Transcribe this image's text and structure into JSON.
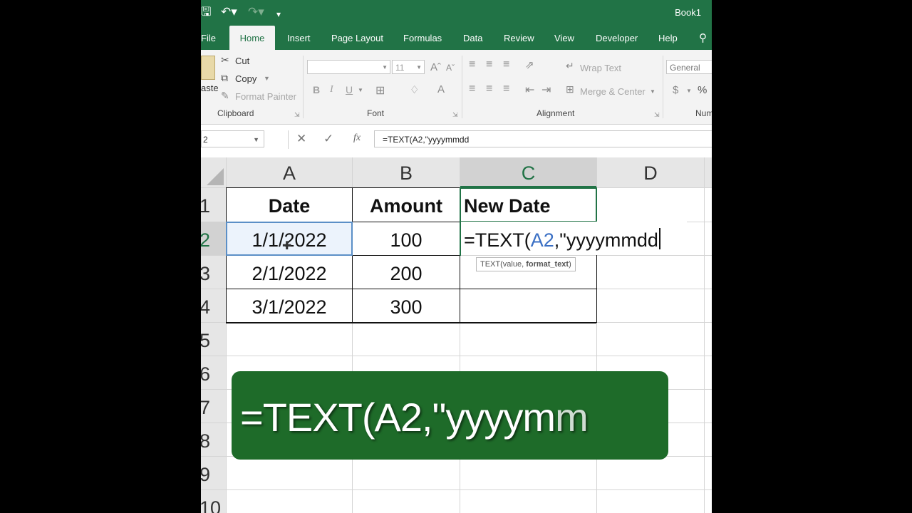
{
  "titlebar": {
    "book_title": "Book1"
  },
  "tabs": [
    "File",
    "Home",
    "Insert",
    "Page Layout",
    "Formulas",
    "Data",
    "Review",
    "View",
    "Developer",
    "Help"
  ],
  "active_tab": "Home",
  "ribbon": {
    "clipboard": {
      "paste": "aste",
      "cut": "Cut",
      "copy": "Copy",
      "format_painter": "Format Painter",
      "label": "Clipboard"
    },
    "font": {
      "name": "",
      "size": "11",
      "label": "Font",
      "bold": "B",
      "italic": "I",
      "underline": "U"
    },
    "alignment": {
      "wrap_text": "Wrap Text",
      "merge_center": "Merge & Center",
      "label": "Alignment"
    },
    "number": {
      "format": "General",
      "label": "Num",
      "currency": "$",
      "percent": "%"
    }
  },
  "formula_bar": {
    "name_box": "2",
    "fx": "fx",
    "formula": "=TEXT(A2,\"yyyymmdd"
  },
  "columns": [
    "A",
    "B",
    "C",
    "D"
  ],
  "rows": [
    "1",
    "2",
    "3",
    "4",
    "5",
    "6",
    "7",
    "8",
    "9",
    "10"
  ],
  "cells": {
    "A1": "Date",
    "B1": "Amount",
    "C1": "New Date",
    "A2": "1/1/2022",
    "B2": "100",
    "A3": "2/1/2022",
    "B3": "200",
    "A4": "3/1/2022",
    "B4": "300"
  },
  "editing": {
    "prefix": "=TEXT(",
    "ref": "A2",
    "suffix": ",\"yyyymmdd"
  },
  "tooltip": {
    "func": "TEXT(value, ",
    "arg": "format_text",
    "close": ")"
  },
  "overlay": {
    "text": "=TEXT(A2,\"yyyym",
    "tail": "m"
  },
  "colors": {
    "excel_green": "#217346",
    "overlay_green": "#1e6b29",
    "ref_blue": "#3a6fc4"
  }
}
